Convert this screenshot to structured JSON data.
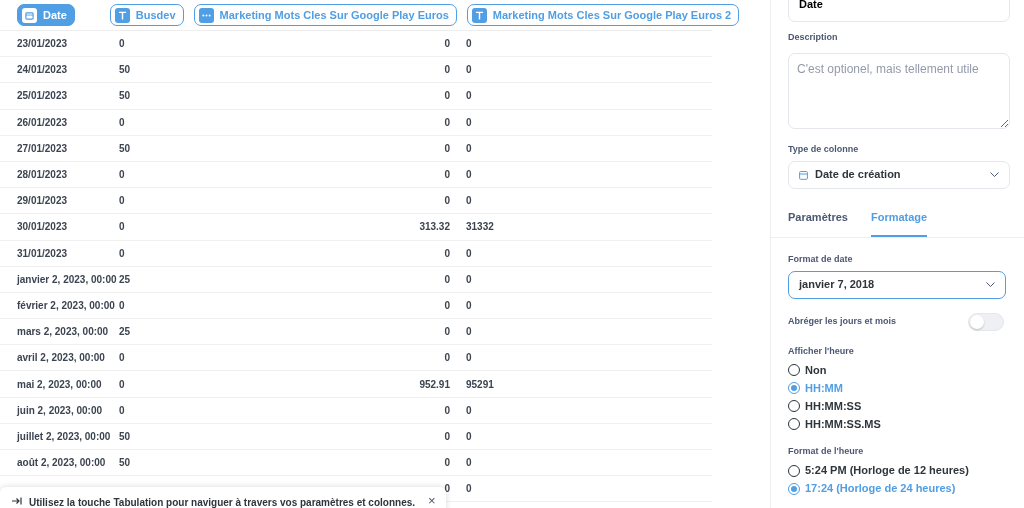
{
  "columns": [
    {
      "label": "Date",
      "kind": "date",
      "selected": true
    },
    {
      "label": "Busdev",
      "kind": "text",
      "selected": false
    },
    {
      "label": "Marketing Mots Cles Sur Google Play Euros",
      "kind": "other",
      "selected": false
    },
    {
      "label": "Marketing Mots Cles Sur Google Play Euros 2",
      "kind": "text",
      "selected": false
    }
  ],
  "rows": [
    [
      "23/01/2023",
      "0",
      "0",
      "0"
    ],
    [
      "24/01/2023",
      "50",
      "0",
      "0"
    ],
    [
      "25/01/2023",
      "50",
      "0",
      "0"
    ],
    [
      "26/01/2023",
      "0",
      "0",
      "0"
    ],
    [
      "27/01/2023",
      "50",
      "0",
      "0"
    ],
    [
      "28/01/2023",
      "0",
      "0",
      "0"
    ],
    [
      "29/01/2023",
      "0",
      "0",
      "0"
    ],
    [
      "30/01/2023",
      "0",
      "313.32",
      "31332"
    ],
    [
      "31/01/2023",
      "0",
      "0",
      "0"
    ],
    [
      "janvier 2, 2023, 00:00",
      "25",
      "0",
      "0"
    ],
    [
      "février 2, 2023, 00:00",
      "0",
      "0",
      "0"
    ],
    [
      "mars 2, 2023, 00:00",
      "25",
      "0",
      "0"
    ],
    [
      "avril 2, 2023, 00:00",
      "0",
      "0",
      "0"
    ],
    [
      "mai 2, 2023, 00:00",
      "0",
      "952.91",
      "95291"
    ],
    [
      "juin 2, 2023, 00:00",
      "0",
      "0",
      "0"
    ],
    [
      "juillet 2, 2023, 00:00",
      "50",
      "0",
      "0"
    ],
    [
      "août 2, 2023, 00:00",
      "50",
      "0",
      "0"
    ],
    {
      "column_3": "0",
      "column_4": "0"
    }
  ],
  "toast": {
    "text": "Utilisez la touche Tabulation pour naviguer à travers vos paramètres et colonnes.",
    "close": "×"
  },
  "panel": {
    "name_value": "Date",
    "description_label": "Description",
    "description_placeholder": "C'est optionel, mais tellement utile",
    "type_label": "Type de colonne",
    "type_value": "Date de création",
    "tabs": [
      {
        "label": "Paramètres",
        "selected": false
      },
      {
        "label": "Formatage",
        "selected": true
      }
    ],
    "date_format_label": "Format de date",
    "date_format_value": "janvier 7, 2018",
    "abbreviate": {
      "label": "Abréger les jours et mois",
      "on": false
    },
    "time_label": "Afficher l'heure",
    "time_options": [
      {
        "label": "Non",
        "selected": false
      },
      {
        "label": "HH:MM",
        "selected": true
      },
      {
        "label": "HH:MM:SS",
        "selected": false
      },
      {
        "label": "HH:MM:SS.MS",
        "selected": false
      }
    ],
    "clock_label": "Format de l'heure",
    "clock_options": [
      {
        "label": "5:24 PM (Horloge de 12 heures)",
        "selected": false
      },
      {
        "label": "17:24 (Horloge de 24 heures)",
        "selected": true
      }
    ]
  }
}
